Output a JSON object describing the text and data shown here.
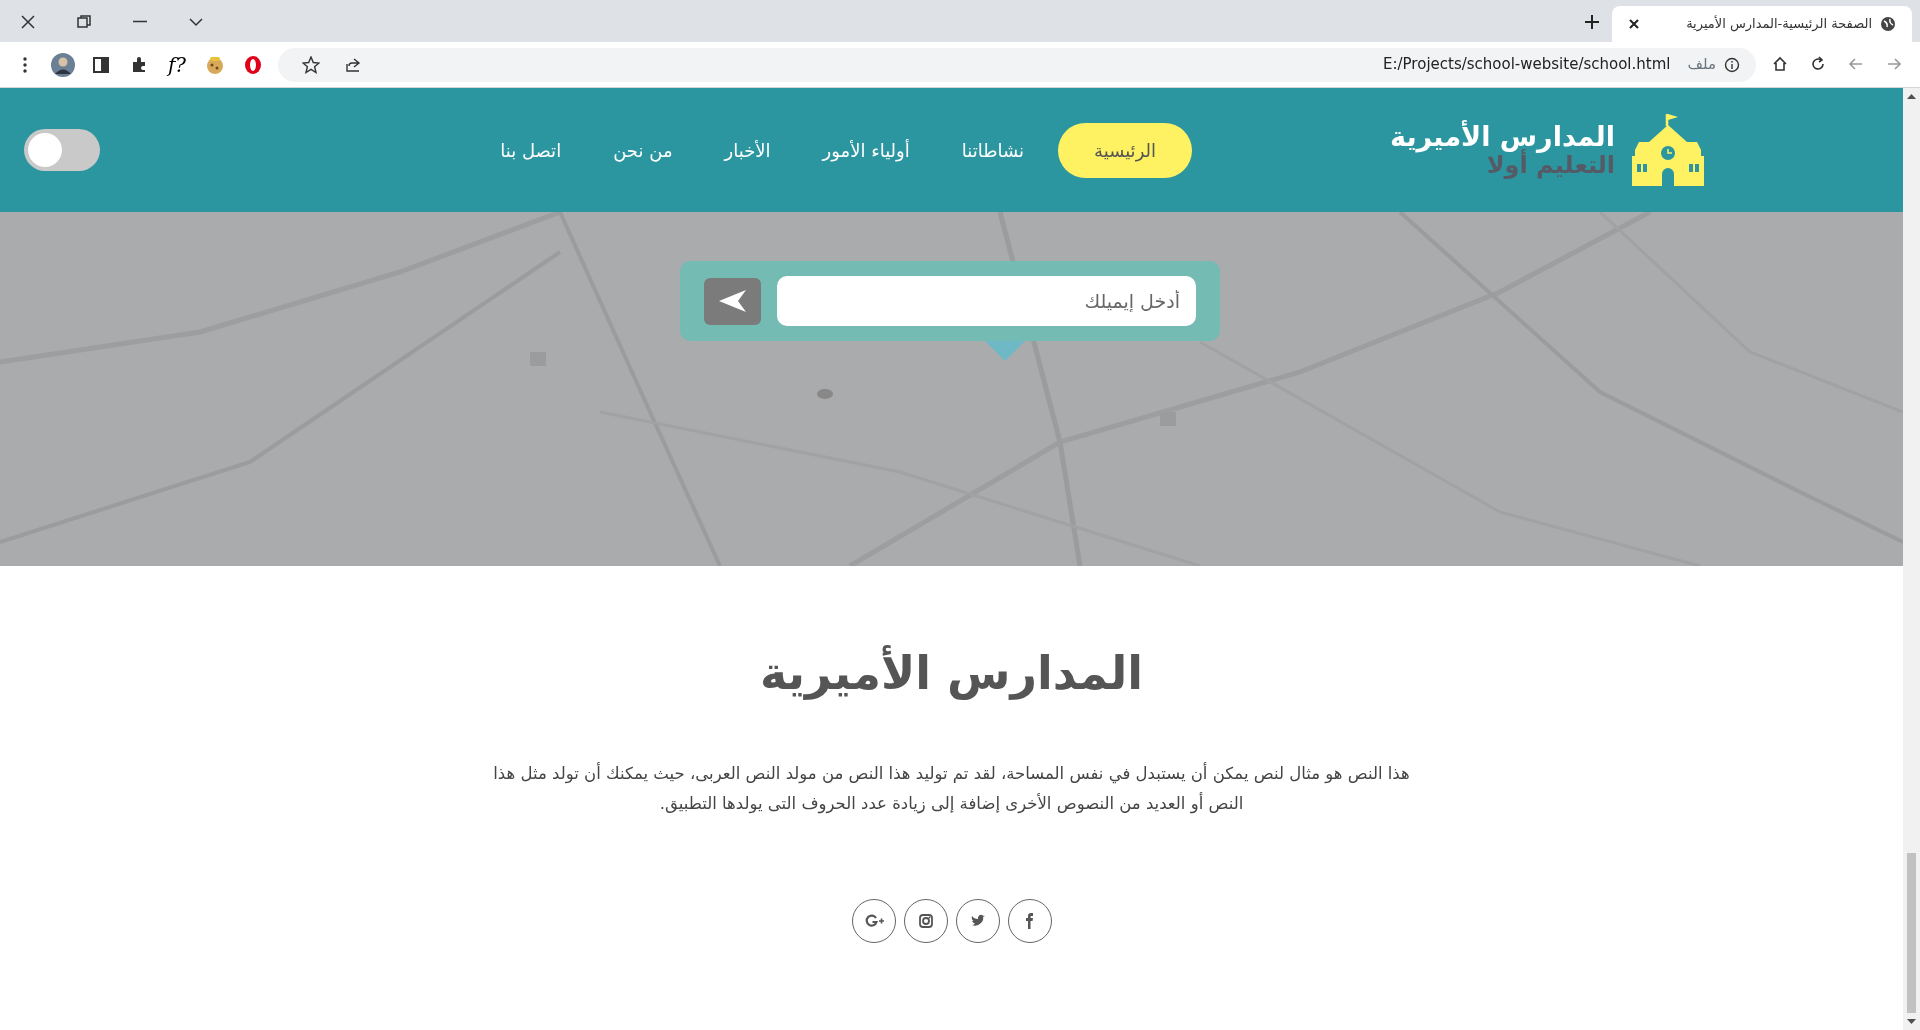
{
  "browser": {
    "tab": {
      "title": "الصفحة الرئيسية-المدارس الأميرية",
      "selected": true
    },
    "address": {
      "scheme_label": "ملف",
      "url": "E:/Projects/school-website/school.html"
    },
    "extension_label": "f?"
  },
  "navbar": {
    "brand": {
      "title": "المدارس الأميرية",
      "tagline": "التعليم أولا"
    },
    "links": [
      {
        "label": "الرئيسية",
        "selected": true
      },
      {
        "label": "نشاطاتنا",
        "selected": false
      },
      {
        "label": "أولياء الأمور",
        "selected": false
      },
      {
        "label": "الأخبار",
        "selected": false
      },
      {
        "label": "من نحن",
        "selected": false
      },
      {
        "label": "اتصل بنا",
        "selected": false
      }
    ],
    "theme_toggle": {
      "on": false
    }
  },
  "subscribe": {
    "placeholder": "أدخل إيميلك"
  },
  "about": {
    "heading": "المدارس الأميرية",
    "text": "هذا النص هو مثال لنص يمكن أن يستبدل في نفس المساحة، لقد تم توليد هذا النص من مولد النص العربى، حيث يمكنك أن تولد مثل هذا النص أو العديد من النصوص الأخرى إضافة إلى زيادة عدد الحروف التى يولدها التطبيق."
  },
  "social": [
    {
      "kind": "facebook"
    },
    {
      "kind": "twitter"
    },
    {
      "kind": "instagram"
    },
    {
      "kind": "google-plus"
    }
  ]
}
